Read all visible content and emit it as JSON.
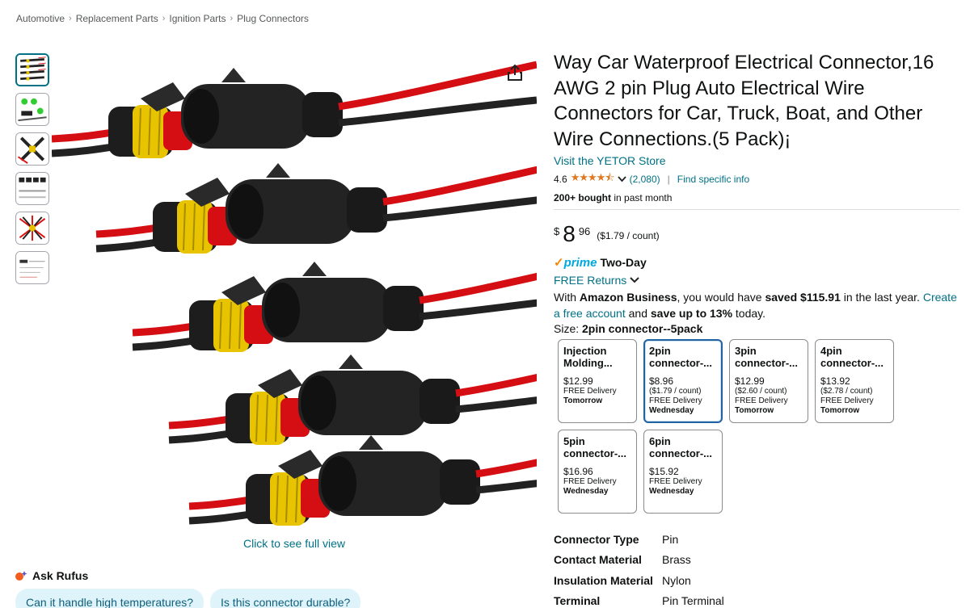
{
  "breadcrumb": [
    "Automotive",
    "Replacement Parts",
    "Ignition Parts",
    "Plug Connectors"
  ],
  "gallery": {
    "thumbnail_count": 6,
    "full_view_label": "Click to see full view"
  },
  "rufus": {
    "label": "Ask Rufus",
    "chips": [
      "Can it handle high temperatures?",
      "Is this connector durable?"
    ]
  },
  "product": {
    "title": "Way Car Waterproof Electrical Connector,16 AWG 2 pin Plug Auto Electrical Wire Connectors for Car, Truck, Boat, and Other Wire Connections.(5 Pack)¡",
    "store_link": "Visit the YETOR Store",
    "rating": "4.6",
    "stars": "★★★★⯪",
    "review_count": "(2,080)",
    "find_info": "Find specific info",
    "bought_bold": "200+ bought",
    "bought_rest": " in past month",
    "price_symbol": "$",
    "price_whole": "8",
    "price_fraction": "96",
    "unit_price": "($1.79 / count)",
    "prime_two_day": "Two-Day",
    "prime_word": "prime",
    "free_returns": "FREE Returns",
    "business": {
      "p1": "With ",
      "b1": "Amazon Business",
      "p2": ", you would have ",
      "b2": "saved $115.91",
      "p3": " in the last year. ",
      "link": "Create a free account",
      "p4": " and ",
      "b3": "save up to 13%",
      "p5": " today."
    },
    "size_label": "Size: ",
    "size_value": "2pin connector--5pack"
  },
  "size_options": [
    {
      "name": "Injection Molding...",
      "price": "$12.99",
      "unit": "",
      "delivery": "FREE Delivery",
      "day": "Tomorrow",
      "selected": false
    },
    {
      "name": "2pin connector-...",
      "price": "$8.96",
      "unit": "($1.79 / count)",
      "delivery": "FREE Delivery",
      "day": "Wednesday",
      "selected": true
    },
    {
      "name": "3pin connector-...",
      "price": "$12.99",
      "unit": "($2.60 / count)",
      "delivery": "FREE Delivery",
      "day": "Tomorrow",
      "selected": false
    },
    {
      "name": "4pin connector-...",
      "price": "$13.92",
      "unit": "($2.78 / count)",
      "delivery": "FREE Delivery",
      "day": "Tomorrow",
      "selected": false
    },
    {
      "name": "5pin connector-...",
      "price": "$16.96",
      "unit": "",
      "delivery": "FREE Delivery",
      "day": "Wednesday",
      "selected": false
    },
    {
      "name": "6pin connector-...",
      "price": "$15.92",
      "unit": "",
      "delivery": "FREE Delivery",
      "day": "Wednesday",
      "selected": false
    }
  ],
  "specs": [
    {
      "key": "Connector Type",
      "value": "Pin"
    },
    {
      "key": "Contact Material",
      "value": "Brass"
    },
    {
      "key": "Insulation Material",
      "value": "Nylon"
    },
    {
      "key": "Terminal",
      "value": "Pin Terminal"
    }
  ],
  "colors": {
    "link": "#007185",
    "star": "#de7921",
    "prime_check": "#f08804",
    "prime_blue": "#00a8e1",
    "selected_border": "#2162a1"
  }
}
